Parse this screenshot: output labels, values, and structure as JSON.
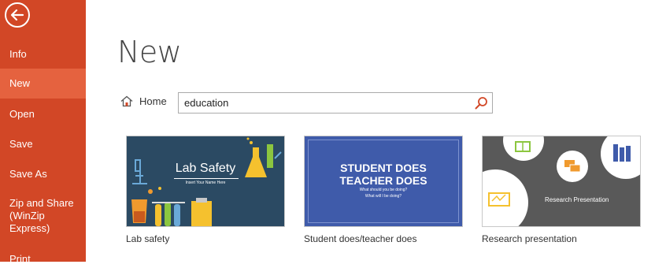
{
  "sidebar": {
    "back_label": "Back",
    "items": [
      {
        "label": "Info"
      },
      {
        "label": "New"
      },
      {
        "label": "Open"
      },
      {
        "label": "Save"
      },
      {
        "label": "Save As"
      },
      {
        "label": "Zip and Share\n(WinZip\nExpress)"
      },
      {
        "label": "Print"
      }
    ],
    "selected": "New",
    "color": "#d24726",
    "selected_color": "#e5623f"
  },
  "page_title": "New",
  "home_link": {
    "label": "Home",
    "icon": "home-icon"
  },
  "search": {
    "value": "education",
    "icon": "search-icon",
    "icon_color": "#d24726"
  },
  "templates": [
    {
      "label": "Lab safety",
      "thumb_title": "Lab Safety",
      "thumb_subtitle": "Insert Your Name Here",
      "bg_color": "#2b4a63"
    },
    {
      "label": "Student does/teacher does",
      "thumb_title_line1": "STUDENT DOES",
      "thumb_title_line2": "TEACHER DOES",
      "thumb_sub1": "What should you be doing?",
      "thumb_sub2": "What will I be doing?",
      "bg_color": "#3f5baa"
    },
    {
      "label": "Research presentation",
      "thumb_title": "Research Presentation",
      "bg_color": "#595959"
    }
  ]
}
